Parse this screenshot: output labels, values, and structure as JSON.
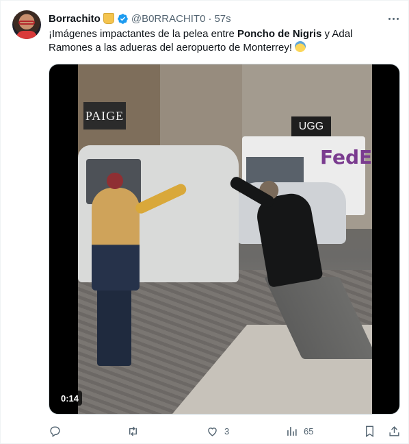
{
  "author": {
    "name": "Borrachito",
    "handle": "@B0RRACHIT0",
    "dot": "·",
    "time": "57s",
    "emoji_icon": "beer-mug-emoji-icon",
    "verified_icon": "verified-badge-icon"
  },
  "tweet": {
    "text_parts": [
      "¡Imágenes impactantes de la pelea entre ",
      "Poncho de Nigris",
      " y Adal Ramones a las adueras del aeropuerto de Monterrey! "
    ],
    "trailing_emoji_icon": "anxious-face-emoji-icon"
  },
  "media": {
    "type": "video",
    "duration": "0:14",
    "sign_left": "PAIGE",
    "sign_right": "UGG",
    "truck_logo": "FedEx"
  },
  "actions": {
    "reply": {
      "icon": "reply-icon",
      "count": ""
    },
    "retweet": {
      "icon": "retweet-icon",
      "count": ""
    },
    "like": {
      "icon": "heart-icon",
      "count": "3"
    },
    "views": {
      "icon": "bar-chart-icon",
      "count": "65"
    },
    "bookmark": {
      "icon": "bookmark-icon",
      "count": ""
    },
    "share": {
      "icon": "share-icon",
      "count": ""
    }
  },
  "colors": {
    "text_primary": "#0f1419",
    "text_secondary": "#536471",
    "verified_blue": "#1d9bf0",
    "border": "#eff3f4"
  }
}
